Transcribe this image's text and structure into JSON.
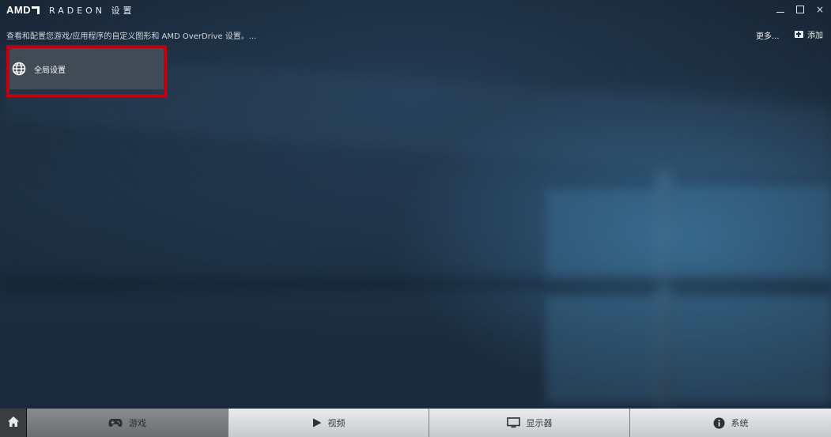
{
  "titlebar": {
    "logo": "AMD",
    "app_title": "RADEON 设置",
    "minimize_label": "",
    "maximize_label": "",
    "close_label": "×"
  },
  "header": {
    "subtitle": "查看和配置您游戏/应用程序的自定义图形和 AMD OverDrive 设置。...",
    "more_label": "更多...",
    "add_label": "添加"
  },
  "tiles": [
    {
      "label": "全局设置",
      "icon": "globe-icon",
      "selected": true
    }
  ],
  "bottom_nav": {
    "home_icon": "home-icon",
    "items": [
      {
        "label": "游戏",
        "icon": "gamepad-icon",
        "active": true
      },
      {
        "label": "视频",
        "icon": "play-icon",
        "active": false
      },
      {
        "label": "显示器",
        "icon": "monitor-icon",
        "active": false
      },
      {
        "label": "系统",
        "icon": "info-icon",
        "active": false
      }
    ]
  },
  "colors": {
    "highlight": "#c0000f",
    "tile_bg": "#414b55",
    "background": "#1c2d3f"
  }
}
